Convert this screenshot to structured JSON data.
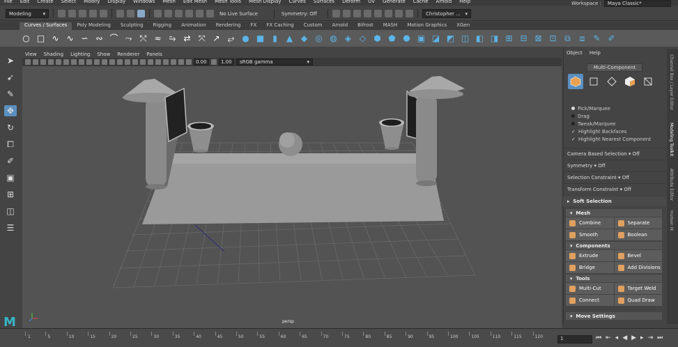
{
  "menubar": {
    "items": [
      "File",
      "Edit",
      "Create",
      "Select",
      "Modify",
      "Display",
      "Windows",
      "Mesh",
      "Edit Mesh",
      "Mesh Tools",
      "Mesh Display",
      "Curves",
      "Surfaces",
      "Deform",
      "UV",
      "Generate",
      "Cache",
      "Arnold",
      "Help"
    ],
    "workspace_label": "Workspace :",
    "workspace_value": "Maya Classic*"
  },
  "statusline": {
    "mode": "Modeling",
    "live_surface": "No Live Surface",
    "symmetry": "Symmetry: Off",
    "user": "Christopher ..."
  },
  "shelf": {
    "tabs": [
      "Curves / Surfaces",
      "Poly Modeling",
      "Sculpting",
      "Rigging",
      "Animation",
      "Rendering",
      "FX",
      "FX Caching",
      "Custom",
      "Arnold",
      "Bifrost",
      "MASH",
      "Motion Graphics",
      "XGen"
    ],
    "active_tab": 0
  },
  "viewport": {
    "menus": [
      "View",
      "Shading",
      "Lighting",
      "Show",
      "Renderer",
      "Panels"
    ],
    "exposure": "0.00",
    "gamma": "1.00",
    "color_space": "sRGB gamma",
    "camera_label": "persp"
  },
  "right_panel": {
    "menus": [
      "Object",
      "Help"
    ],
    "title": "Multi-Component",
    "radios": [
      "Pick/Marquee",
      "Drag",
      "Tweak/Marquee"
    ],
    "checks": [
      "Highlight Backfaces",
      "Highlight Nearest Component"
    ],
    "rows": [
      {
        "label": "Camera Based Selection",
        "value": "Off"
      },
      {
        "label": "Symmetry",
        "value": "Off"
      },
      {
        "label": "Selection Constraint",
        "value": "Off"
      },
      {
        "label": "Transform Constraint",
        "value": "Off"
      }
    ],
    "soft_selection": "Soft Selection",
    "sections": [
      {
        "title": "Mesh",
        "buttons": [
          [
            "Combine",
            "Separate"
          ],
          [
            "Smooth",
            "Boolean"
          ]
        ]
      },
      {
        "title": "Components",
        "buttons": [
          [
            "Extrude",
            "Bevel"
          ],
          [
            "Bridge",
            "Add Divisions"
          ]
        ]
      },
      {
        "title": "Tools",
        "buttons": [
          [
            "Multi-Cut",
            "Target Weld"
          ],
          [
            "Connect",
            "Quad Draw"
          ]
        ]
      }
    ],
    "move_settings": "Move Settings",
    "side_tabs": [
      "Channel Box / Layer Editor",
      "Modeling Toolkit",
      "Attribute Editor",
      "Human IK"
    ]
  },
  "timeline": {
    "ticks": [
      "1",
      "5",
      "10",
      "15",
      "20",
      "25",
      "30",
      "35",
      "40",
      "45",
      "50",
      "55",
      "60",
      "65",
      "70",
      "75",
      "80",
      "85",
      "90",
      "95",
      "100",
      "105",
      "110",
      "115",
      "120"
    ],
    "current_frame": "1"
  },
  "colors": {
    "accent": "#5b8fc0",
    "maya_logo": "#36b5c6",
    "shelf_icon": "#5cb4e8"
  }
}
